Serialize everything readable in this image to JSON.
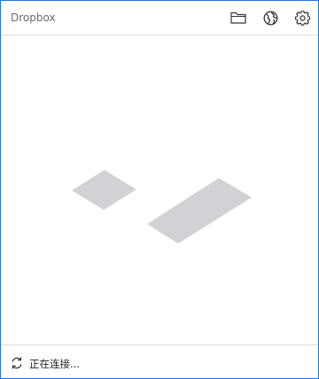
{
  "window": {
    "title": "Dropbox"
  },
  "header": {
    "icons": [
      "folder-icon",
      "globe-icon",
      "gear-icon"
    ]
  },
  "main": {
    "illustration": "loading-placeholder-shapes",
    "shape_color": "#d2d2d6"
  },
  "footer": {
    "status_icon": "sync-icon",
    "status_text": "正在连接..."
  },
  "colors": {
    "border": "#1e7ad6",
    "divider": "#dcdcdc",
    "title_text": "#6b6b6b",
    "icon": "#333333"
  }
}
